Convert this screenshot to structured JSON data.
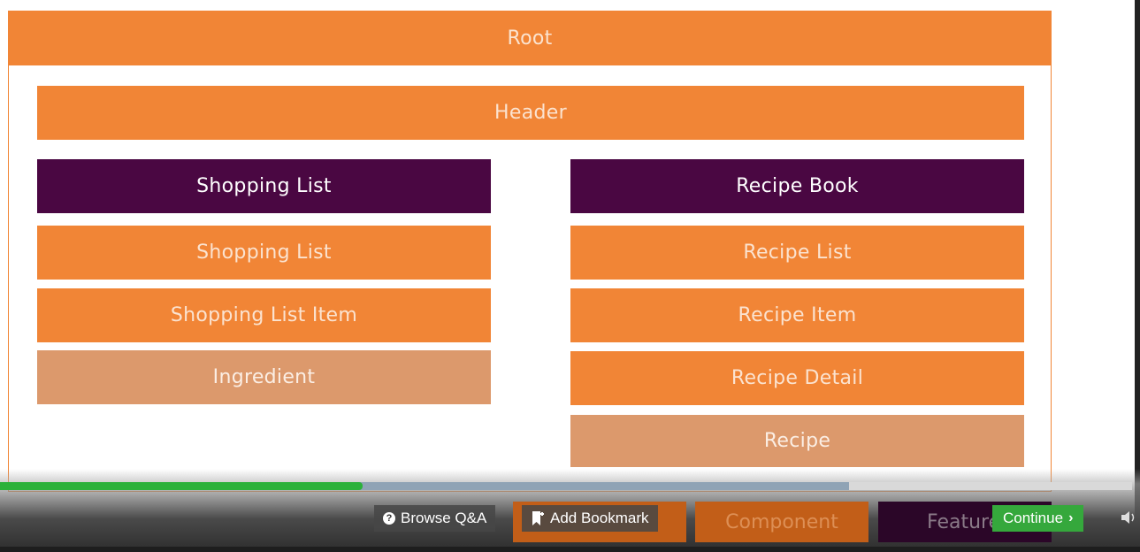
{
  "diagram": {
    "root": "Root",
    "header": "Header",
    "shopping": {
      "feature": "Shopping List",
      "list": "Shopping List",
      "item": "Shopping List Item",
      "ingredient": "Ingredient"
    },
    "recipes": {
      "feature": "Recipe Book",
      "list": "Recipe List",
      "item": "Recipe Item",
      "detail": "Recipe Detail",
      "recipe": "Recipe"
    }
  },
  "player": {
    "progress_percent": 32,
    "buffered_percent": 75,
    "legend": {
      "component": "Component",
      "feature": "Feature"
    },
    "browse_qa": "Browse Q&A",
    "add_bookmark": "Add Bookmark",
    "continue": "Continue"
  },
  "colors": {
    "component_orange": "#f18536",
    "feature_purple": "#4a0742",
    "model_tan": "#dc996c",
    "progress_green": "#2bb13a",
    "continue_green": "#35a83c"
  },
  "icons": [
    "question-circle-icon",
    "bookmark-plus-icon",
    "chevron-right-icon",
    "speaker-icon"
  ]
}
